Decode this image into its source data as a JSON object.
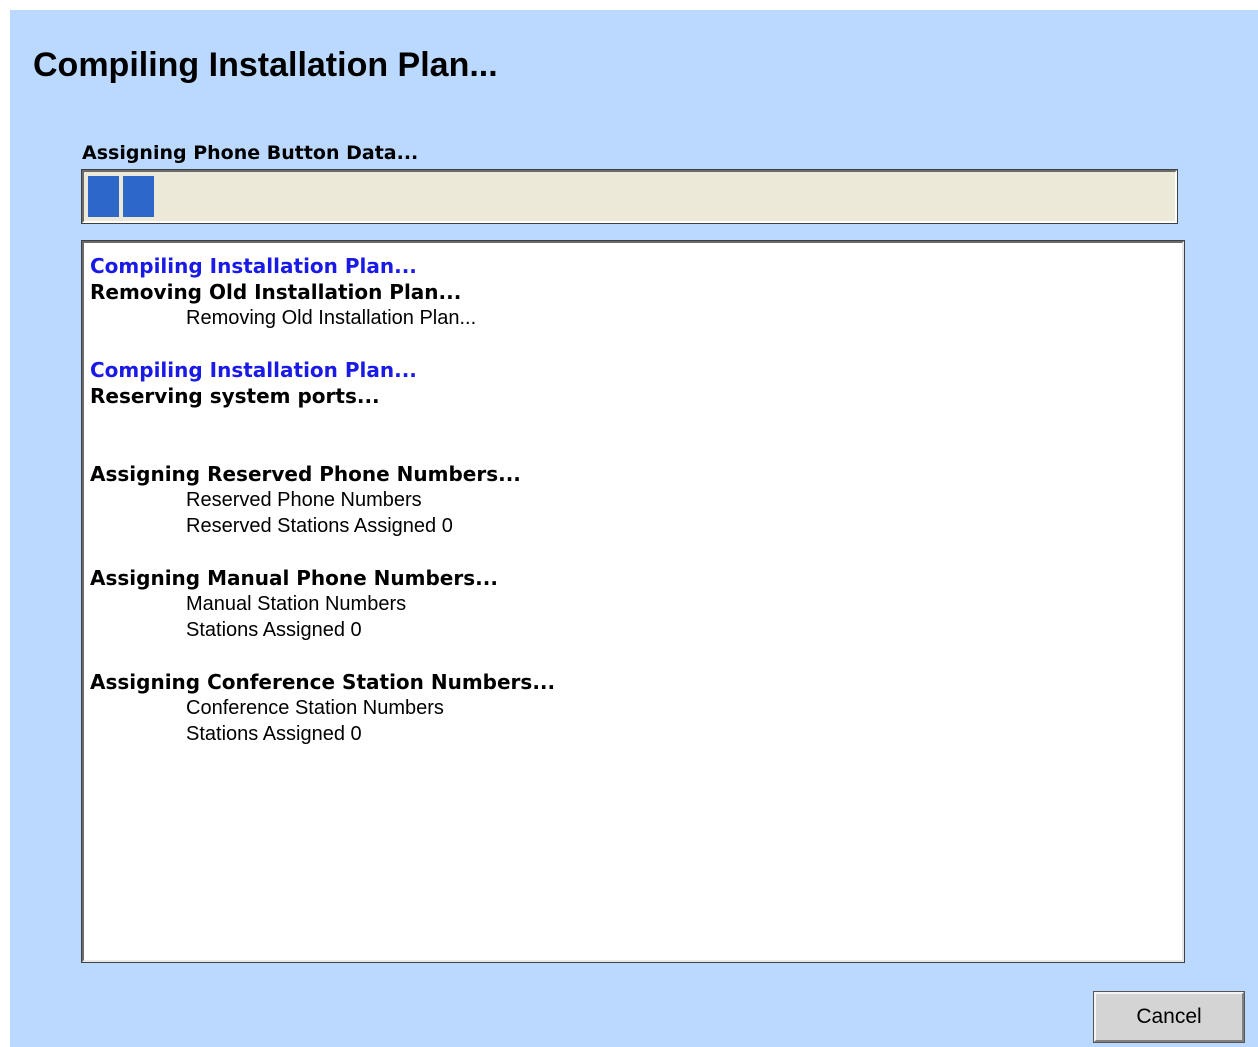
{
  "dialog": {
    "title": "Compiling Installation Plan...",
    "status_text": "Assigning Phone Button Data...",
    "progress": {
      "blocks_filled": 2,
      "fill_color": "#2d67c8",
      "track_color": "#ece9d8"
    },
    "background_color": "#bbd9fe",
    "log": {
      "line_1": "Compiling Installation Plan...",
      "line_2": "Removing Old Installation Plan...",
      "line_3": "Removing Old Installation Plan...",
      "line_5": "Compiling Installation Plan...",
      "line_6": "Reserving system ports...",
      "line_9": "Assigning Reserved Phone Numbers...",
      "line_10": "Reserved Phone Numbers",
      "line_11": "Reserved Stations Assigned  0",
      "line_13": "Assigning Manual Phone Numbers...",
      "line_14": "Manual Station Numbers",
      "line_15": "Stations Assigned  0",
      "line_17": "Assigning Conference Station Numbers...",
      "line_18": "Conference Station Numbers",
      "line_19": "Stations Assigned 0",
      "heading_blue_color": "#1a1ae6"
    },
    "cancel_label": "Cancel"
  }
}
